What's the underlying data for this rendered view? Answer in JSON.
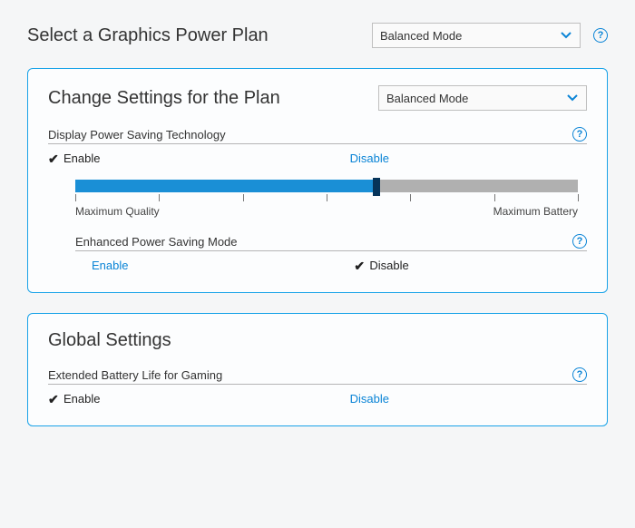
{
  "top": {
    "title": "Select a Graphics Power Plan",
    "select_value": "Balanced Mode",
    "help": "?"
  },
  "plan_panel": {
    "title": "Change Settings for the Plan",
    "select_value": "Balanced Mode",
    "dpst": {
      "label": "Display Power Saving Technology",
      "help": "?",
      "enable": "Enable",
      "disable": "Disable",
      "selected": "enable",
      "slider": {
        "left_label": "Maximum Quality",
        "right_label": "Maximum Battery",
        "value_pct": 60
      }
    },
    "epsm": {
      "label": "Enhanced Power Saving Mode",
      "help": "?",
      "enable": "Enable",
      "disable": "Disable",
      "selected": "disable"
    }
  },
  "global_panel": {
    "title": "Global Settings",
    "eblg": {
      "label": "Extended Battery Life for Gaming",
      "help": "?",
      "enable": "Enable",
      "disable": "Disable",
      "selected": "enable"
    }
  }
}
